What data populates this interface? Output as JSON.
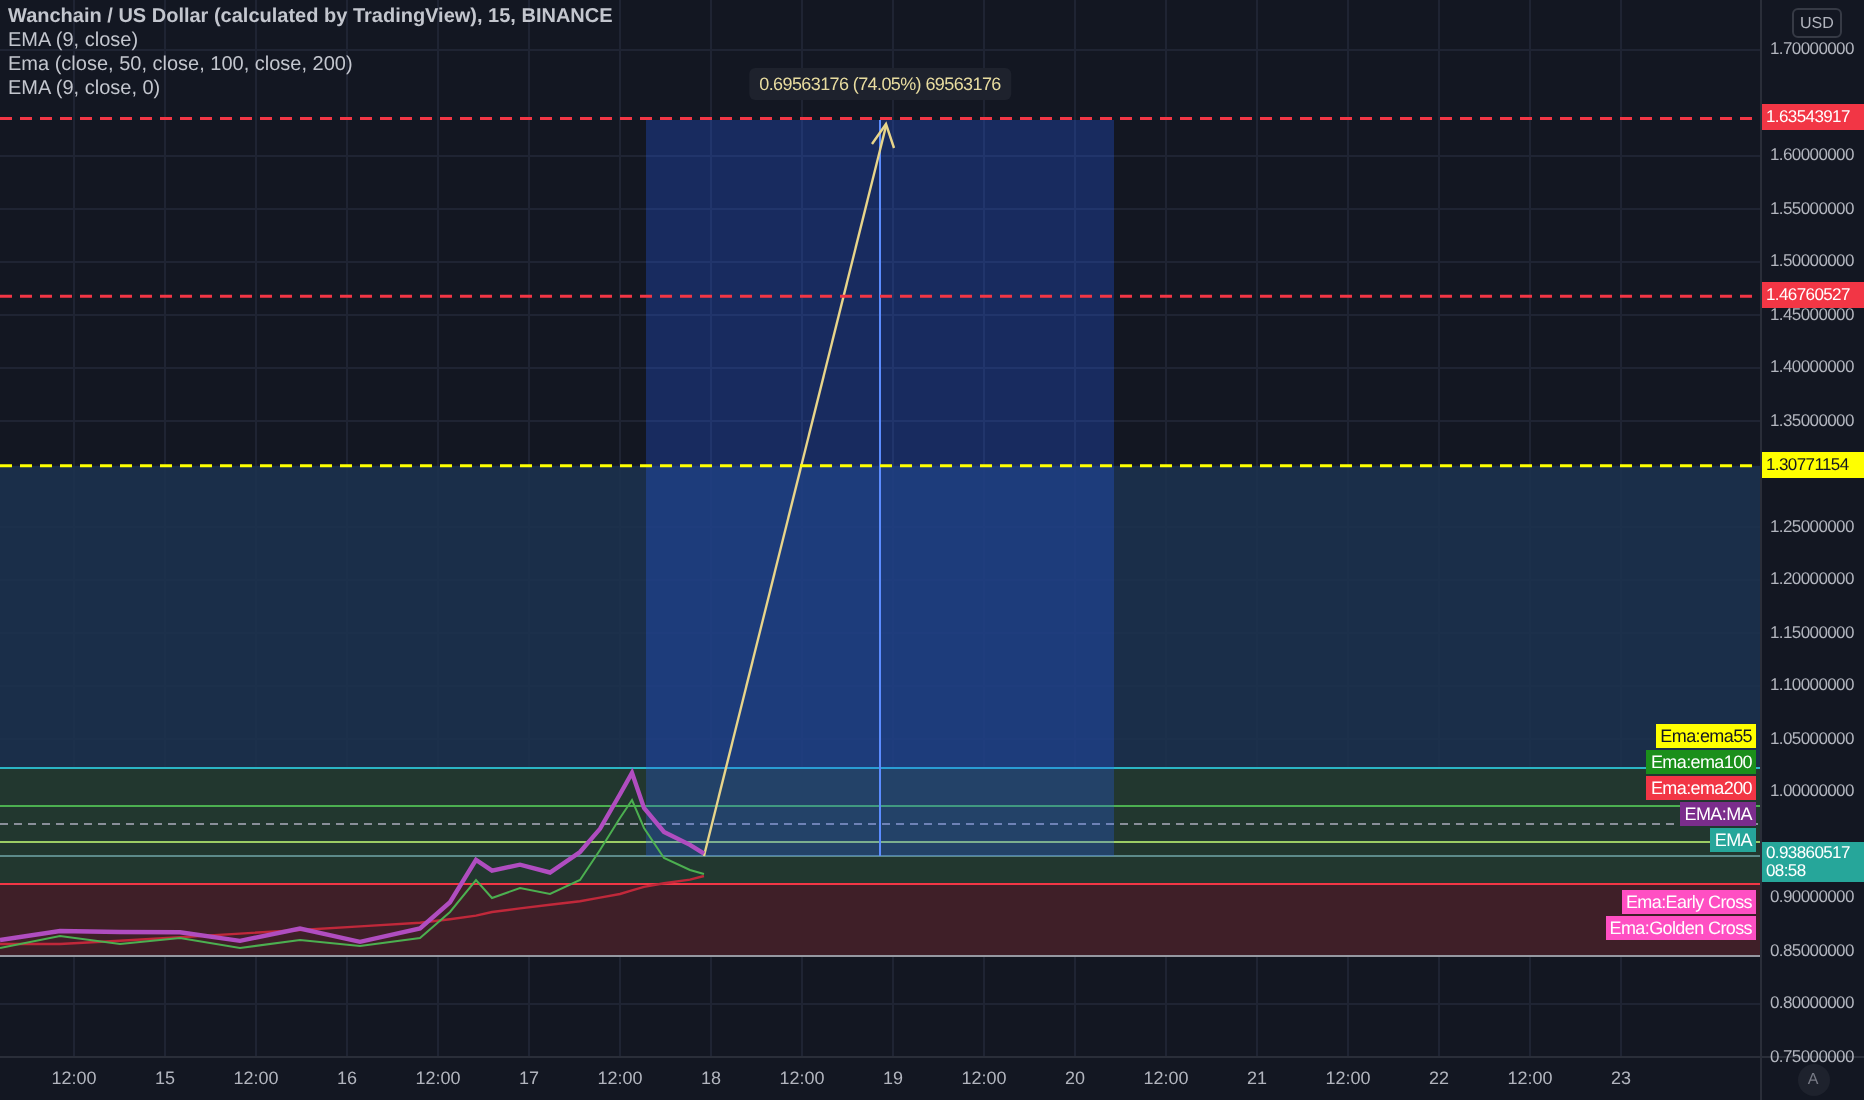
{
  "legend": {
    "title": "Wanchain / US Dollar (calculated by TradingView), 15, BINANCE",
    "indicators": [
      "EMA (9, close)",
      "Ema (close, 50, close, 100, close, 200)",
      "EMA (9, close, 0)"
    ]
  },
  "measure": {
    "label": "0.69563176 (74.05%) 69563176"
  },
  "levels": [
    {
      "label": "1.63543917",
      "color": "#f23645"
    },
    {
      "label": "1.46760527",
      "color": "#f23645"
    },
    {
      "label": "1.30771154",
      "color": "#ffff00"
    }
  ],
  "indicator_tags": [
    {
      "label": "Ema:ema55",
      "color": "#ffff00"
    },
    {
      "label": "Ema:ema100",
      "color": "#1b8f1b"
    },
    {
      "label": "Ema:ema200",
      "color": "#f23645"
    },
    {
      "label": "EMA:MA",
      "color": "#7b2d8c"
    },
    {
      "label": "EMA",
      "color": "#26a69a"
    },
    {
      "label": "Ema:Early Cross",
      "color": "#ff4fc3"
    },
    {
      "label": "Ema:Golden Cross",
      "color": "#ff4fc3"
    }
  ],
  "current_price": {
    "price": "0.93860517",
    "countdown": "08:58",
    "color": "#26a69a"
  },
  "price_axis": {
    "unit": "USD",
    "ticks": [
      "1.70000000",
      "1.60000000",
      "1.55000000",
      "1.50000000",
      "1.45000000",
      "1.40000000",
      "1.35000000",
      "1.25000000",
      "1.20000000",
      "1.15000000",
      "1.10000000",
      "1.05000000",
      "1.00000000",
      "0.90000000",
      "0.85000000",
      "0.80000000",
      "0.75000000"
    ],
    "auto_button": "A"
  },
  "time_axis": {
    "ticks": [
      "12:00",
      "15",
      "12:00",
      "16",
      "12:00",
      "17",
      "12:00",
      "18",
      "12:00",
      "19",
      "12:00",
      "20",
      "12:00",
      "21",
      "12:00",
      "22",
      "12:00",
      "23"
    ]
  }
}
